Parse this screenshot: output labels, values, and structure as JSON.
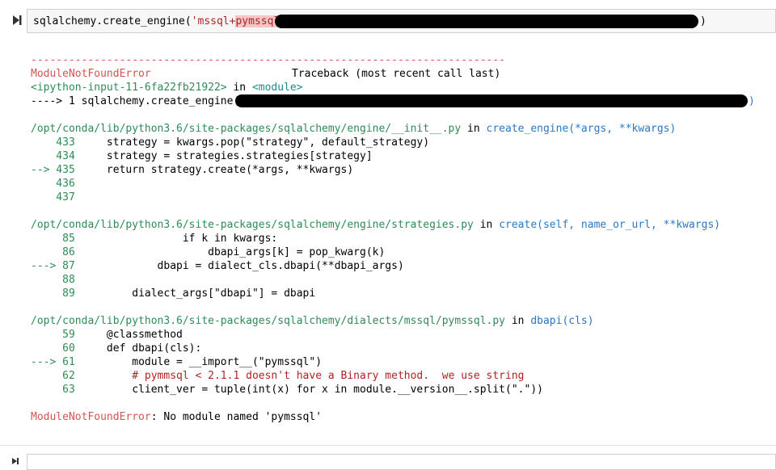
{
  "input_cell": {
    "prefix": "sqlalchemy.create_engine(",
    "string_start": "'mssql+",
    "string_mid": "pymssql:",
    "suffix": ")"
  },
  "traceback": {
    "dashes": "---------------------------------------------------------------------------",
    "error_name": "ModuleNotFoundError",
    "header_right": "Traceback (most recent call last)",
    "input_ref": "<ipython-input-11-6fa22fb21922>",
    "in_word": " in ",
    "module_ref": "<module>",
    "arrow_line_prefix": "----> 1 sqlalchemy.create_engine(",
    "arrow_line_suffix": ")",
    "frames": [
      {
        "path": "/opt/conda/lib/python3.6/site-packages/sqlalchemy/engine/__init__.py",
        "in_word": " in ",
        "func": "create_engine(*args, **kwargs)",
        "lines": [
          {
            "marker": "    433",
            "code": "     strategy = kwargs.pop(\"strategy\", default_strategy)"
          },
          {
            "marker": "    434",
            "code": "     strategy = strategies.strategies[strategy]"
          },
          {
            "marker": "--> 435",
            "code": "     return strategy.create(*args, **kwargs)"
          },
          {
            "marker": "    436",
            "code": ""
          },
          {
            "marker": "    437",
            "code": ""
          }
        ]
      },
      {
        "path": "/opt/conda/lib/python3.6/site-packages/sqlalchemy/engine/strategies.py",
        "in_word": " in ",
        "func": "create(self, name_or_url, **kwargs)",
        "lines": [
          {
            "marker": "     85",
            "code": "                 if k in kwargs:"
          },
          {
            "marker": "     86",
            "code": "                     dbapi_args[k] = pop_kwarg(k)"
          },
          {
            "marker": "---> 87",
            "code": "             dbapi = dialect_cls.dbapi(**dbapi_args)"
          },
          {
            "marker": "     88",
            "code": ""
          },
          {
            "marker": "     89",
            "code": "         dialect_args[\"dbapi\"] = dbapi"
          }
        ]
      },
      {
        "path": "/opt/conda/lib/python3.6/site-packages/sqlalchemy/dialects/mssql/pymssql.py",
        "in_word": " in ",
        "func": "dbapi(cls)",
        "lines": [
          {
            "marker": "     59",
            "code": "     @classmethod"
          },
          {
            "marker": "     60",
            "code": "     def dbapi(cls):"
          },
          {
            "marker": "---> 61",
            "code": "         module = __import__(\"pymssql\")"
          },
          {
            "marker": "     62",
            "code": "         # pymmsql < 2.1.1 doesn't have a Binary method.  we use string"
          },
          {
            "marker": "     63",
            "code": "         client_ver = tuple(int(x) for x in module.__version__.split(\".\"))"
          }
        ]
      }
    ],
    "final_error_name": "ModuleNotFoundError",
    "final_error_msg": ": No module named 'pymssql'"
  }
}
